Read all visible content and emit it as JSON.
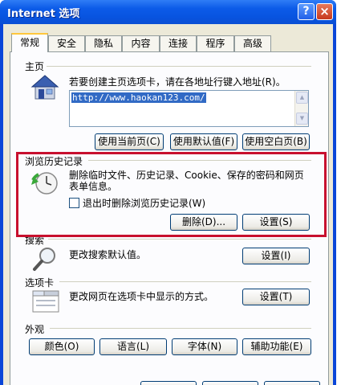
{
  "window": {
    "title": "Internet 选项",
    "help": "?",
    "close": "×"
  },
  "tabs": [
    {
      "label": "常规",
      "active": true
    },
    {
      "label": "安全"
    },
    {
      "label": "隐私"
    },
    {
      "label": "内容"
    },
    {
      "label": "连接"
    },
    {
      "label": "程序"
    },
    {
      "label": "高级"
    }
  ],
  "homepage": {
    "group_label": "主页",
    "description": "若要创建主页选项卡，请在各地址行键入地址(R)。",
    "url": "http://www.haokan123.com/",
    "use_current_label": "使用当前页(C)",
    "use_default_label": "使用默认值(F)",
    "use_blank_label": "使用空白页(B)"
  },
  "history": {
    "group_label": "浏览历史记录",
    "description_line1": "删除临时文件、历史记录、Cookie、保存的密码和网页",
    "description_line2": "表单信息。",
    "checkbox_label": "退出时删除浏览历史记录(W)",
    "checkbox_checked": false,
    "delete_label": "删除(D)...",
    "settings_label": "设置(S)"
  },
  "search": {
    "group_label": "搜索",
    "description": "更改搜索默认值。",
    "settings_label": "设置(I)"
  },
  "tabs_section": {
    "group_label": "选项卡",
    "description": "更改网页在选项卡中显示的方式。",
    "settings_label": "设置(T)"
  },
  "appearance": {
    "group_label": "外观",
    "colors_label": "颜色(O)",
    "languages_label": "语言(L)",
    "fonts_label": "字体(N)",
    "accessibility_label": "辅助功能(E)"
  },
  "colors": {
    "titlebar": "#0c5be8",
    "face": "#ece9d8",
    "highlight": "#c8102e",
    "selection": "#316ac5"
  }
}
